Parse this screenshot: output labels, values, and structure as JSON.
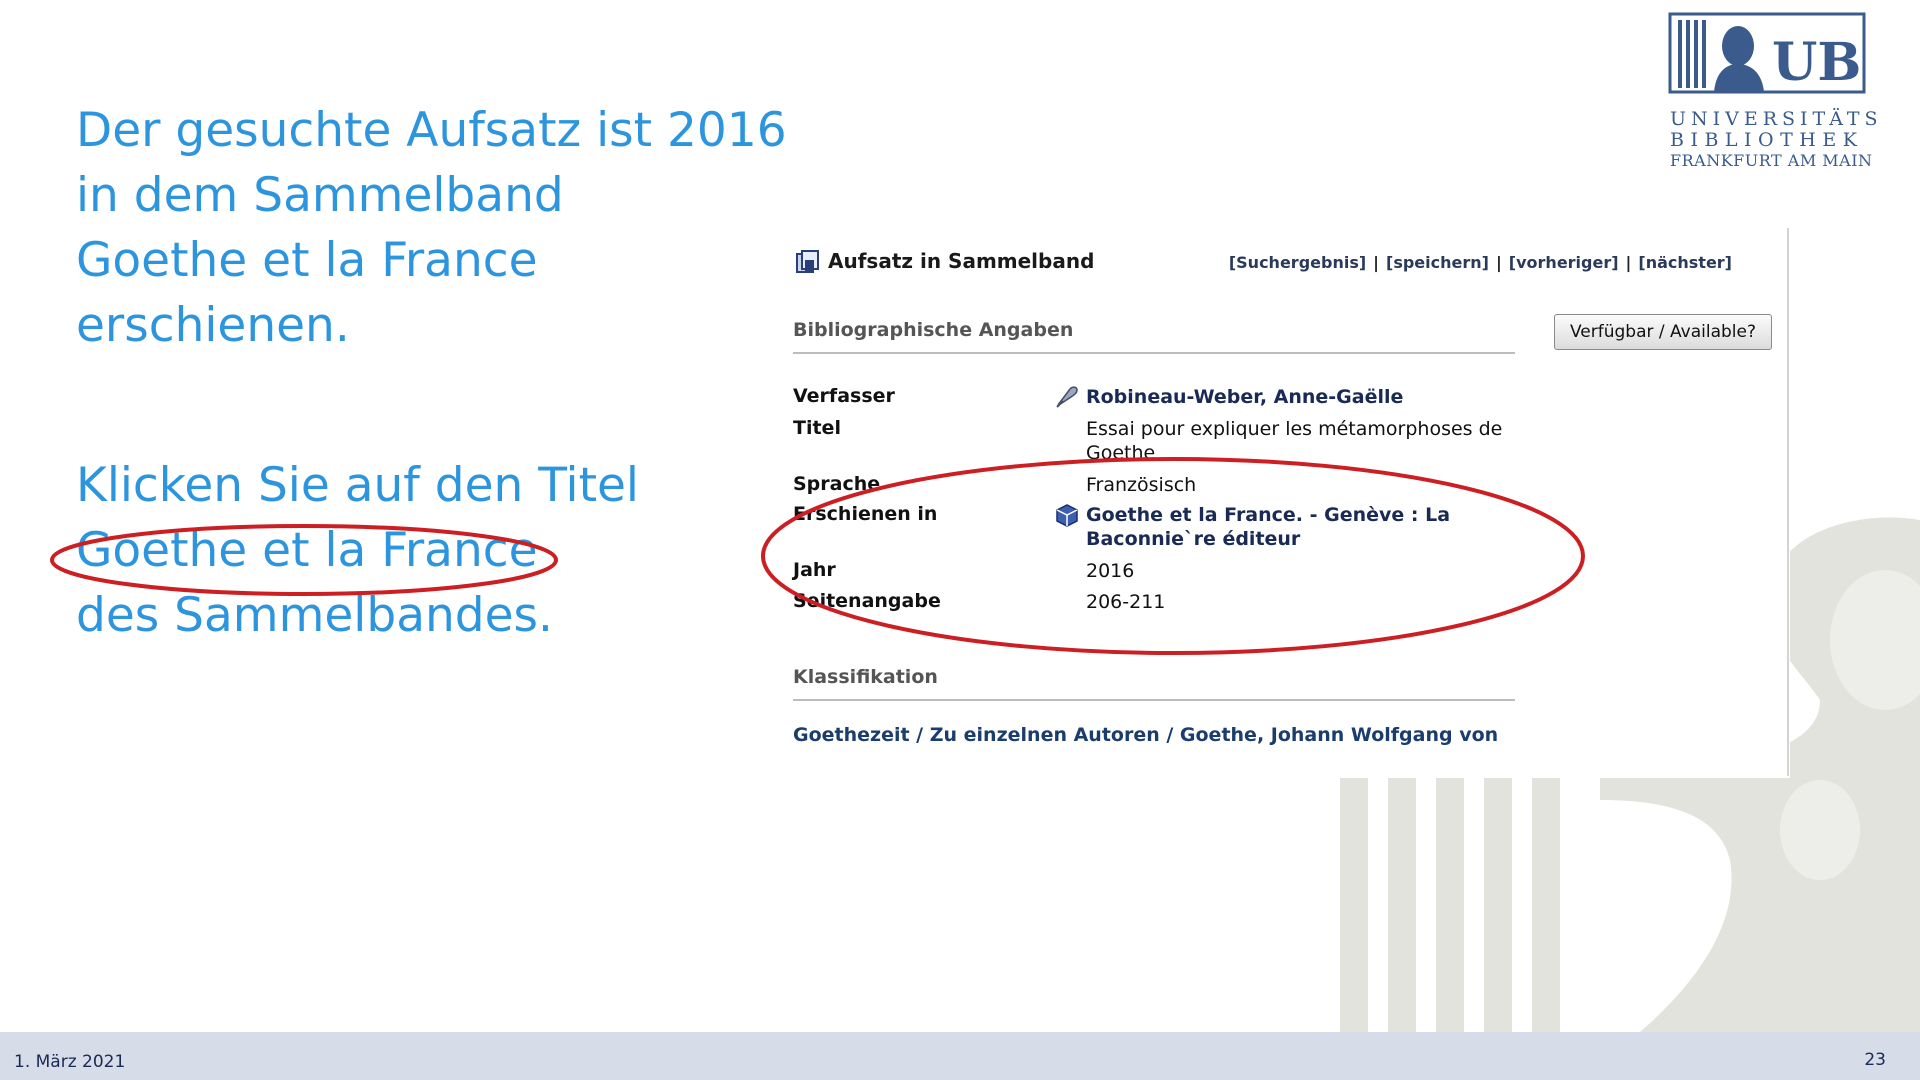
{
  "logo": {
    "mark_text": "UB",
    "line1": "UNIVERSITÄTS",
    "line2": "BIBLIOTHEK",
    "line3": "FRANKFURT AM MAIN"
  },
  "slide": {
    "block1": [
      "Der gesuchte Aufsatz ist 2016",
      "in dem Sammelband",
      "Goethe et la France",
      "erschienen."
    ],
    "block2": [
      "Klicken Sie auf den Titel",
      "Goethe et la France",
      "des Sammelbandes."
    ],
    "text_color": "#2c95dd",
    "highlight_color": "#cc1f24"
  },
  "record": {
    "type_label": "Aufsatz in Sammelband",
    "nav": [
      "[Suchergebnis]",
      "[speichern]",
      "[vorheriger]",
      "[nächster]"
    ],
    "section_biblio": "Bibliographische Angaben",
    "availability_button": "Verfügbar / Available?",
    "fields": {
      "verfasser_label": "Verfasser",
      "verfasser_value": "Robineau-Weber, Anne-Gaëlle",
      "titel_label": "Titel",
      "titel_value": "Essai pour expliquer les métamorphoses de Goethe",
      "sprache_label": "Sprache",
      "sprache_value": "Französisch",
      "erschienen_label": "Erschienen in",
      "erschienen_value": "Goethe et la France. - Genève : La Baconnie`re éditeur",
      "jahr_label": "Jahr",
      "jahr_value": "2016",
      "seiten_label": "Seitenangabe",
      "seiten_value": "206-211"
    },
    "section_klass": "Klassifikation",
    "klassifikation": "Goethezeit / Zu einzelnen Autoren / Goethe, Johann Wolfgang von"
  },
  "footer": {
    "date": "1. März 2021",
    "page": "23"
  }
}
